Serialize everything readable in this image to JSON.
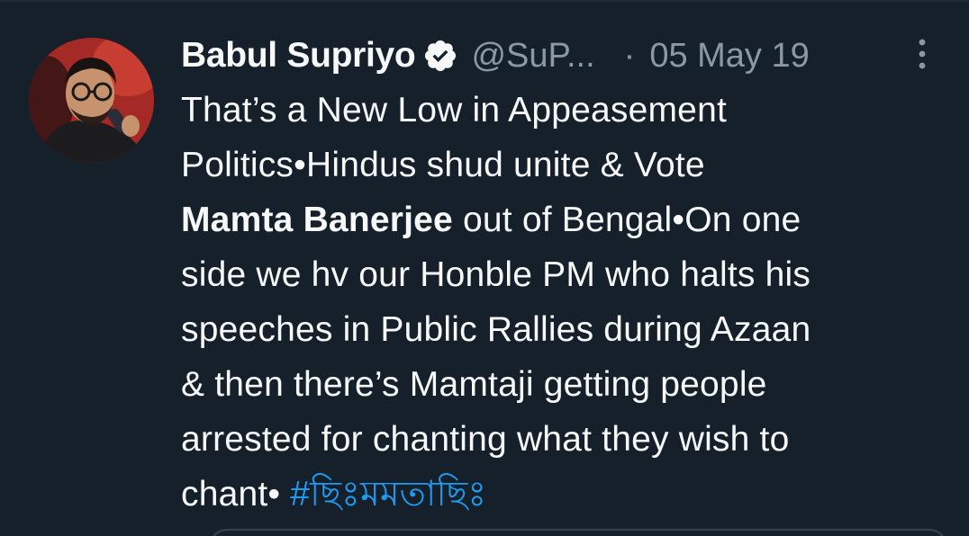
{
  "tweet": {
    "author_name": "Babul Supriyo",
    "handle": "@SuP...",
    "separator": "·",
    "date": "05 May 19",
    "verified": true,
    "icons": {
      "verified": "verified-badge-icon",
      "more": "more-options-icon"
    },
    "body": {
      "line1": "That’s a New Low in Appeasement",
      "line2": "Politics•Hindus shud unite & Vote",
      "line3_bold": "Mamta Banerjee",
      "line3_rest": " out of Bengal•On one",
      "line4": "side we hv our Honble PM who halts his",
      "line5": "speeches in Public Rallies during Azaan",
      "line6": "& then there’s Mamtaji getting people",
      "line7": "arrested for chanting what they wish to",
      "line8_text": "chant• ",
      "hashtag": "#ছিঃমমতাছিঃ"
    }
  },
  "colors": {
    "background": "#15202b",
    "text": "#f7f9f9",
    "muted": "#8b98a5",
    "link": "#1d9bf0"
  }
}
